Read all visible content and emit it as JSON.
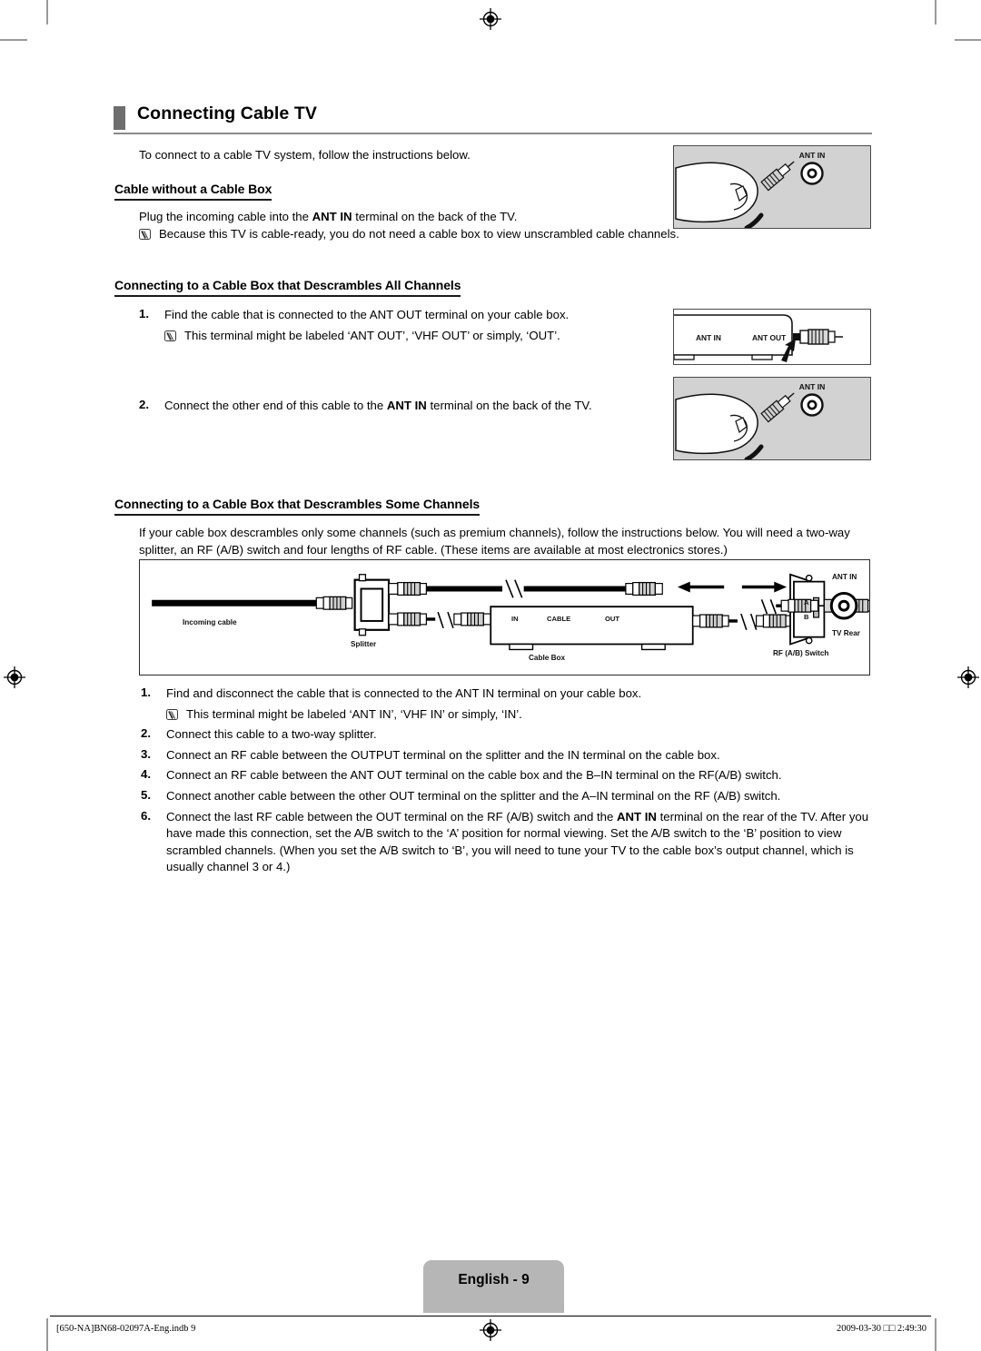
{
  "document": {
    "section_title": "Connecting Cable TV",
    "intro": "To connect to a cable TV system, follow the instructions below."
  },
  "sections": [
    {
      "heading": "Cable without a Cable Box",
      "body": "Plug the incoming cable into the ANT IN terminal on the back of the TV.",
      "body_bold_part": "ANT IN",
      "note": "Because this TV is cable-ready, you do not need a cable box to view unscrambled cable channels."
    },
    {
      "heading": "Connecting to a Cable Box that Descrambles All Channels",
      "steps": [
        {
          "n": "1.",
          "text": "Find the cable that is connected to the ANT OUT terminal on your cable box."
        },
        {
          "n": "2.",
          "text": "Connect the other end of this cable to the ANT IN terminal on the back of the TV."
        }
      ],
      "note": "This terminal might be labeled ‘ANT OUT’, ‘VHF OUT’ or simply, ‘OUT’."
    },
    {
      "heading": "Connecting to a Cable Box that Descrambles Some Channels",
      "body": "If your cable box descrambles only some channels (such as premium channels), follow the instructions below. You will need a two-way splitter, an RF (A/B) switch and four lengths of RF cable. (These items are available at most electronics stores.)",
      "steps": [
        {
          "n": "1.",
          "text": "Find and disconnect the cable that is connected to the ANT IN terminal on your cable box."
        },
        {
          "n": "2.",
          "text": "Connect this cable to a two-way splitter."
        },
        {
          "n": "3.",
          "text": "Connect an RF cable between the OUTPUT terminal on the splitter and the IN terminal on the cable box."
        },
        {
          "n": "4.",
          "text": "Connect an RF cable between the ANT OUT terminal on the cable box and the B–IN terminal on the RF(A/B) switch."
        },
        {
          "n": "5.",
          "text": "Connect another cable between the other OUT terminal on the splitter and the A–IN terminal on the RF (A/B) switch."
        },
        {
          "n": "6.",
          "text": "Connect the last RF cable between the OUT terminal on the RF (A/B) switch and the ANT IN terminal on the rear of the TV. After you have made this connection, set the A/B switch to the ‘A’ position for normal viewing. Set the A/B switch to the ‘B’ position to view scrambled channels. (When you set the A/B switch to ‘B’, you will need to tune your TV to the cable box’s output channel, which is usually channel 3 or 4.)"
        }
      ],
      "step1_note": "This terminal might be labeled ‘ANT IN’, ‘VHF IN’ or simply, ‘IN’."
    }
  ],
  "step_fragments": {
    "s1_pre": "Find and disconnect the cable that is connected to the ANT IN terminal on your cable box.",
    "s6_bold": "ANT IN",
    "s6_a": "Connect the last RF cable between the OUT terminal on the RF (A/B) switch and the ",
    "s6_b": " terminal on the rear of the TV. After you have made this connection, set the A/B switch to the ‘A’ position for normal viewing. Set the A/B switch to the ‘B’ position to view scrambled channels. (When you set the A/B switch to ‘B’, you will need to tune your TV to the cable box’s output channel, which is usually channel 3 or 4.)",
    "s2_a": "Connect the other end of this cable to the ",
    "s2_b": " terminal on the back of the TV.",
    "body1_a": "Plug the incoming cable into the ",
    "body1_b": " terminal on the back of the TV."
  },
  "illustrations": {
    "panel1": {
      "label_ant_in": "ANT IN"
    },
    "panel2": {
      "label_ant_in": "ANT IN",
      "label_ant_out": "ANT OUT"
    },
    "panel3": {
      "label_ant_in": "ANT IN"
    }
  },
  "diagram": {
    "labels": {
      "incoming_cable": "Incoming cable",
      "splitter": "Splitter",
      "cable_box": "Cable Box",
      "cable_box_in": "IN",
      "cable_box_cable": "CABLE",
      "cable_box_out": "OUT",
      "rf_switch": "RF (A/B) Switch",
      "switch_a": "A",
      "switch_b": "B",
      "ant_in": "ANT IN",
      "tv_rear": "TV Rear"
    }
  },
  "footer": {
    "page_label": "English - 9",
    "file_ref": "[650-NA]BN68-02097A-Eng.indb   9",
    "timestamp": "2009-03-30   □□ 2:49:30"
  },
  "colors": {
    "header_bar": "#6e6e6e",
    "header_rule": "#8a8a8a",
    "illustration_bg": "#d2d2d2",
    "page_tab_bg": "#b6b6b6",
    "crop_mark": "#9a9a9a"
  }
}
